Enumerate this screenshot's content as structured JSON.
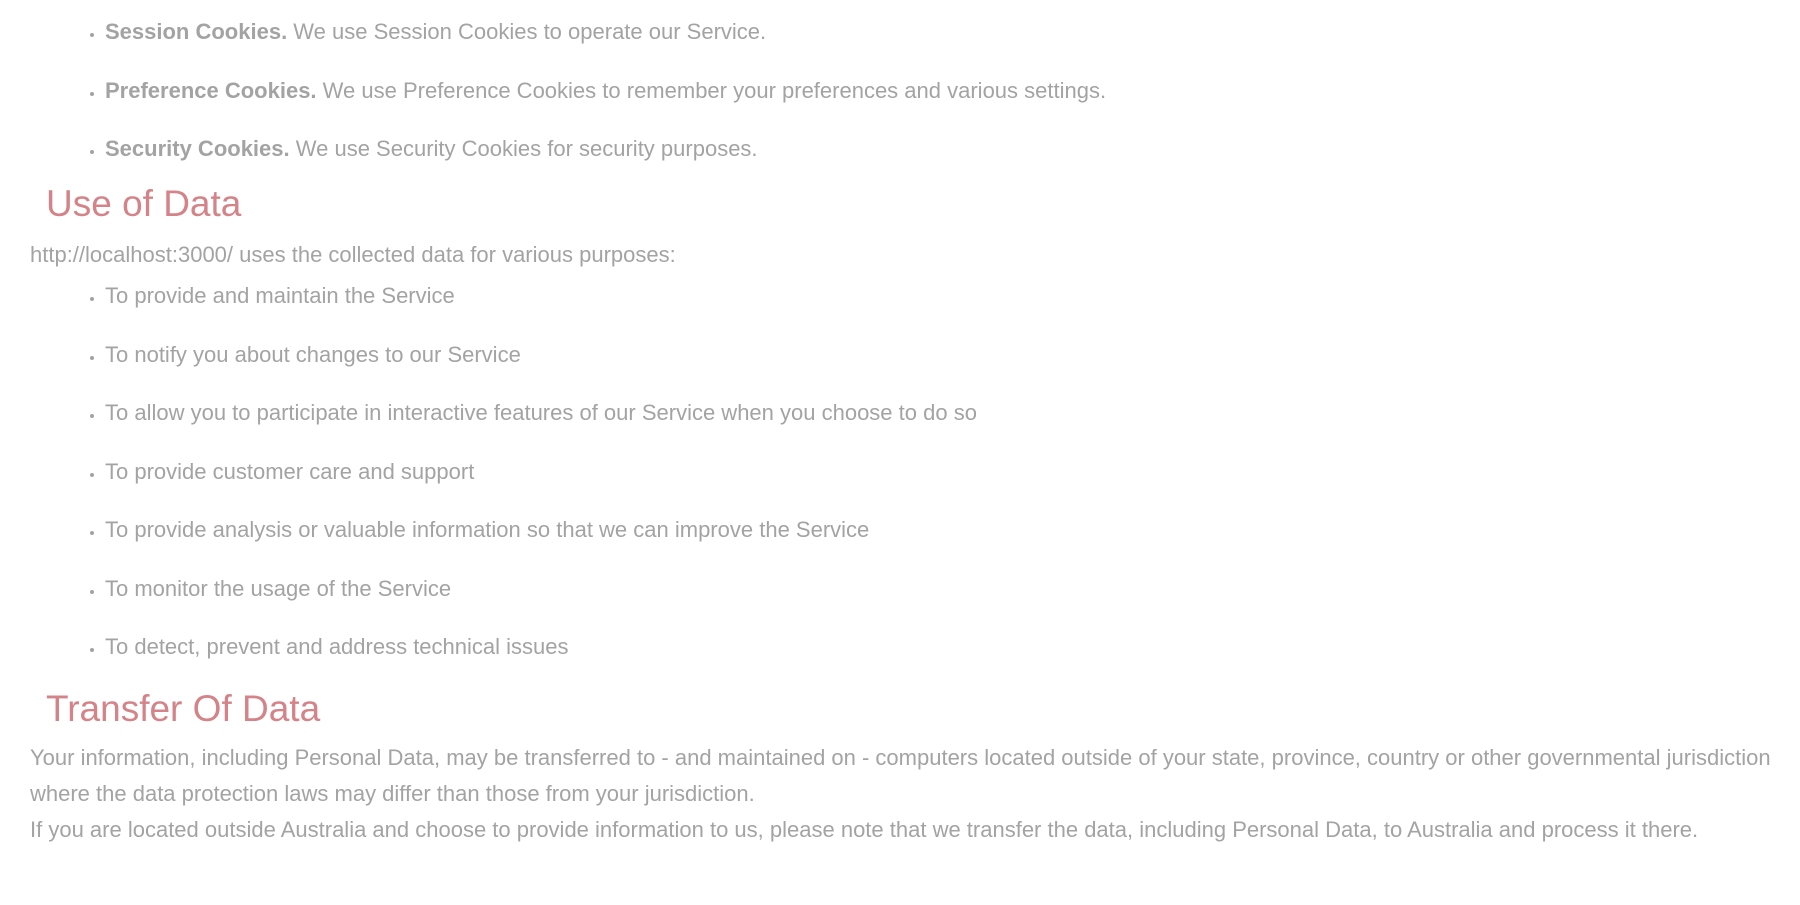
{
  "cookie_types": [
    {
      "title": "Session Cookies.",
      "text": " We use Session Cookies to operate our Service."
    },
    {
      "title": "Preference Cookies.",
      "text": " We use Preference Cookies to remember your preferences and various settings."
    },
    {
      "title": "Security Cookies.",
      "text": " We use Security Cookies for security purposes."
    }
  ],
  "use_of_data": {
    "heading": "Use of Data",
    "intro": "http://localhost:3000/ uses the collected data for various purposes:",
    "items": [
      "To provide and maintain the Service",
      "To notify you about changes to our Service",
      "To allow you to participate in interactive features of our Service when you choose to do so",
      "To provide customer care and support",
      "To provide analysis or valuable information so that we can improve the Service",
      "To monitor the usage of the Service",
      "To detect, prevent and address technical issues"
    ]
  },
  "transfer_of_data": {
    "heading": "Transfer Of Data",
    "paragraph1": "Your information, including Personal Data, may be transferred to - and maintained on - computers located outside of your state, province, country or other governmental jurisdiction where the data protection laws may differ than those from your jurisdiction.",
    "paragraph2": "If you are located outside Australia and choose to provide information to us, please note that we transfer the data, including Personal Data, to Australia and process it there."
  },
  "colors": {
    "text": "#a3a3a3",
    "heading": "#d48388",
    "background": "#ffffff"
  }
}
